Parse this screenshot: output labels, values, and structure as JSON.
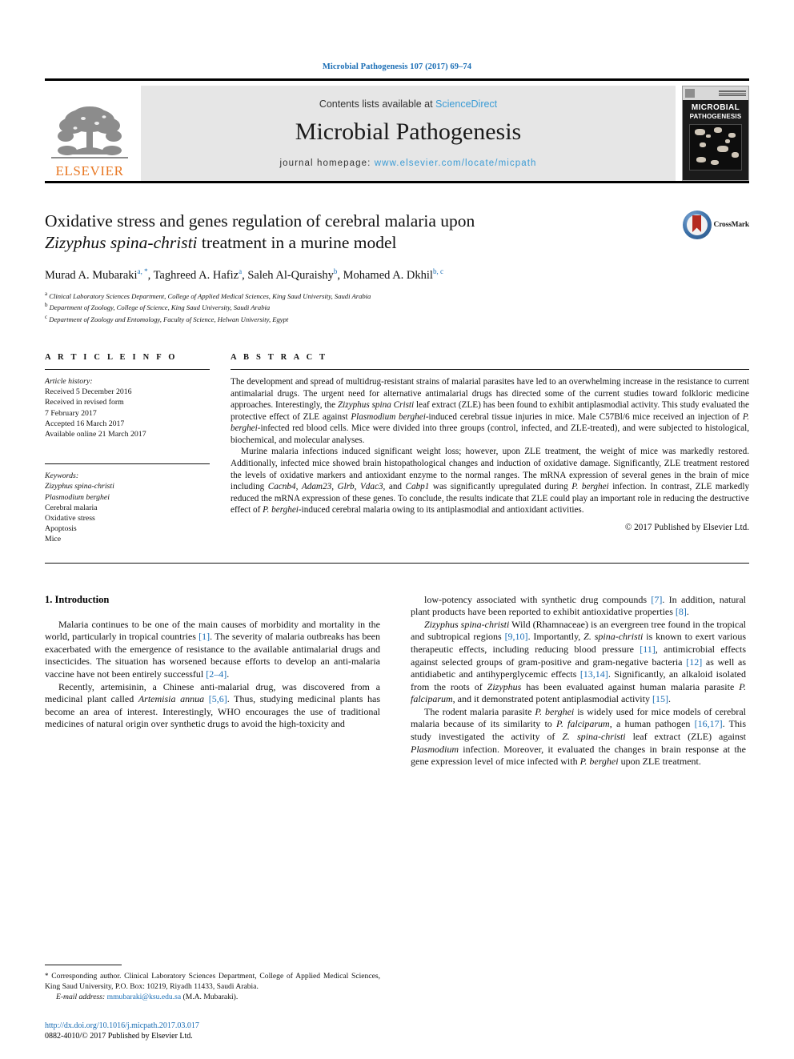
{
  "running_head": "Microbial Pathogenesis 107 (2017) 69–74",
  "masthead": {
    "publisher_logo_label": "ELSEVIER",
    "contents_prefix": "Contents lists available at ",
    "contents_link": "ScienceDirect",
    "journal_title": "Microbial Pathogenesis",
    "homepage_prefix": "journal homepage: ",
    "homepage_url": "www.elsevier.com/locate/micpath",
    "cover_title_line1": "MICROBIAL",
    "cover_title_line2": "PATHOGENESIS"
  },
  "article": {
    "title_line1": "Oxidative stress and genes regulation of cerebral malaria upon",
    "title_line2_italic": "Zizyphus spina-christi",
    "title_line2_rest": " treatment in a murine model",
    "crossmark_label": "CrossMark",
    "authors": [
      {
        "name": "Murad A. Mubaraki",
        "marks": "a, *"
      },
      {
        "name": "Taghreed A. Hafiz",
        "marks": "a"
      },
      {
        "name": "Saleh Al-Quraishy",
        "marks": "b"
      },
      {
        "name": "Mohamed A. Dkhil",
        "marks": "b, c"
      }
    ],
    "affiliations": [
      {
        "mark": "a",
        "text": "Clinical Laboratory Sciences Department, College of Applied Medical Sciences, King Saud University, Saudi Arabia"
      },
      {
        "mark": "b",
        "text": "Department of Zoology, College of Science, King Saud University, Saudi Arabia"
      },
      {
        "mark": "c",
        "text": "Department of Zoology and Entomology, Faculty of Science, Helwan University, Egypt"
      }
    ]
  },
  "article_info": {
    "heading": "A R T I C L E   I N F O",
    "history_label": "Article history:",
    "history": [
      "Received 5 December 2016",
      "Received in revised form",
      "7 February 2017",
      "Accepted 16 March 2017",
      "Available online 21 March 2017"
    ],
    "keywords_label": "Keywords:",
    "keywords": [
      {
        "text": "Zizyphus spina-christi",
        "italic": true
      },
      {
        "text": "Plasmodium berghei",
        "italic": true
      },
      {
        "text": "Cerebral malaria",
        "italic": false
      },
      {
        "text": "Oxidative stress",
        "italic": false
      },
      {
        "text": "Apoptosis",
        "italic": false
      },
      {
        "text": "Mice",
        "italic": false
      }
    ]
  },
  "abstract": {
    "heading": "A B S T R A C T",
    "paragraph1_html": "The development and spread of multidrug-resistant strains of malarial parasites have led to an overwhelming increase in the resistance to current antimalarial drugs. The urgent need for alternative antimalarial drugs has directed some of the current studies toward folkloric medicine approaches. Interestingly, the <em>Zizyphus spina Cristi</em> leaf extract (ZLE) has been found to exhibit antiplasmodial activity. This study evaluated the protective effect of ZLE against <em>Plasmodium berghei</em>-induced cerebral tissue injuries in mice. Male C57Bl/6 mice received an injection of <em>P. berghei</em>-infected red blood cells. Mice were divided into three groups (control, infected, and ZLE-treated), and were subjected to histological, biochemical, and molecular analyses.",
    "paragraph2_html": "Murine malaria infections induced significant weight loss; however, upon ZLE treatment, the weight of mice was markedly restored. Additionally, infected mice showed brain histopathological changes and induction of oxidative damage. Significantly, ZLE treatment restored the levels of oxidative markers and antioxidant enzyme to the normal ranges. The mRNA expression of several genes in the brain of mice including <em>Cacnb4</em>, <em>Adam23</em>, <em>Glrb</em>, <em>Vdac3</em>, and <em>Cabp1</em> was significantly upregulated during <em>P. berghei</em> infection. In contrast, ZLE markedly reduced the mRNA expression of these genes. To conclude, the results indicate that ZLE could play an important role in reducing the destructive effect of <em>P. berghei</em>-induced cerebral malaria owing to its antiplasmodial and antioxidant activities.",
    "copyright": "© 2017 Published by Elsevier Ltd."
  },
  "introduction": {
    "heading": "1.  Introduction",
    "left_paragraphs_html": [
      "Malaria continues to be one of the main causes of morbidity and mortality in the world, particularly in tropical countries <span class=\"ref\">[1]</span>. The severity of malaria outbreaks has been exacerbated with the emergence of resistance to the available antimalarial drugs and insecticides. The situation has worsened because efforts to develop an anti-malaria vaccine have not been entirely successful <span class=\"ref\">[2–4]</span>.",
      "Recently, artemisinin, a Chinese anti-malarial drug, was discovered from a medicinal plant called <em>Artemisia annua</em> <span class=\"ref\">[5,6]</span>. Thus, studying medicinal plants has become an area of interest. Interestingly, WHO encourages the use of traditional medicines of natural origin over synthetic drugs to avoid the high-toxicity and"
    ],
    "right_paragraphs_html": [
      "low-potency associated with synthetic drug compounds <span class=\"ref\">[7]</span>. In addition, natural plant products have been reported to exhibit antioxidative properties <span class=\"ref\">[8]</span>.",
      "<em>Zizyphus spina-christi</em> Wild (Rhamnaceae) is an evergreen tree found in the tropical and subtropical regions <span class=\"ref\">[9,10]</span>. Importantly, <em>Z. spina-christi</em> is known to exert various therapeutic effects, including reducing blood pressure <span class=\"ref\">[11]</span>, antimicrobial effects against selected groups of gram-positive and gram-negative bacteria <span class=\"ref\">[12]</span> as well as antidiabetic and antihyperglycemic effects <span class=\"ref\">[13,14]</span>. Significantly, an alkaloid isolated from the roots of <em>Zizyphus</em> has been evaluated against human malaria parasite <em>P. falciparum</em>, and it demonstrated potent antiplasmodial activity <span class=\"ref\">[15]</span>.",
      "The rodent malaria parasite <em>P. berghei</em> is widely used for mice models of cerebral malaria because of its similarity to <em>P. falciparum</em>, a human pathogen <span class=\"ref\">[16,17]</span>. This study investigated the activity of <em>Z. spina-christi</em> leaf extract (ZLE) against <em>Plasmodium</em> infection. Moreover, it evaluated the changes in brain response at the gene expression level of mice infected with <em>P. berghei</em> upon ZLE treatment."
    ]
  },
  "footnote": {
    "corresponding_html": "<span class=\"star\">*</span> Corresponding author. Clinical Laboratory Sciences Department, College of Applied Medical Sciences, King Saud University, P.O. Box: 10219, Riyadh 11433, Saudi Arabia.",
    "email_label": "E-mail address:",
    "email": "mmubaraki@ksu.edu.sa",
    "email_suffix": " (M.A. Mubaraki).",
    "doi": "http://dx.doi.org/10.1016/j.micpath.2017.03.017",
    "issn_line": "0882-4010/© 2017 Published by Elsevier Ltd."
  },
  "colors": {
    "link": "#1b6eb5",
    "science_direct": "#3a9bd5",
    "elsevier_orange": "#e87722"
  }
}
